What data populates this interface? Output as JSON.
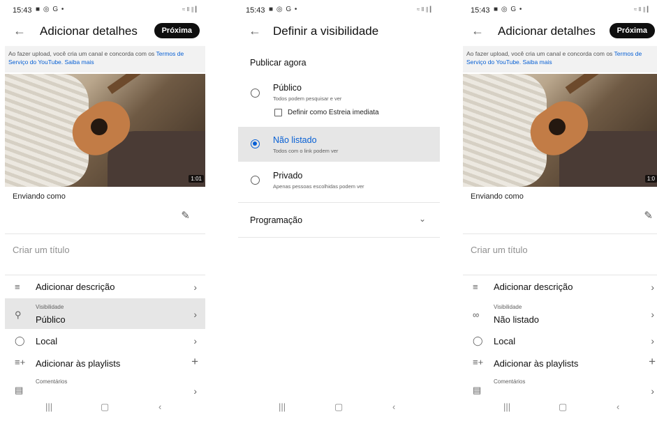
{
  "status": {
    "time": "15:43",
    "icons": "■ ◎ G •",
    "right": "≈ Ⅱ ∥ ▎"
  },
  "screens": {
    "details_public": {
      "back_icon": "←",
      "title": "Adicionar detalhes",
      "next_label": "Próxima",
      "banner_text": "Ao fazer upload, você cria um canal e concorda com os ",
      "banner_link1": "Termos de Serviço do YouTube.",
      "banner_link2": "Saiba mais",
      "duration": "1:01",
      "sending_as": "Enviando como",
      "title_placeholder": "Criar um título",
      "add_description": "Adicionar descrição",
      "visibility_label": "Visibilidade",
      "visibility_value": "Público",
      "location": "Local",
      "add_playlists": "Adicionar às playlists",
      "comments": "Comentários"
    },
    "visibility": {
      "back_icon": "←",
      "title": "Definir a visibilidade",
      "section": "Publicar agora",
      "options": [
        {
          "label": "Público",
          "sub": "Todos podem pesquisar e ver",
          "selected": false
        },
        {
          "label": "Não listado",
          "sub": "Todos com o link podem ver",
          "selected": true
        },
        {
          "label": "Privado",
          "sub": "Apenas pessoas escolhidas podem ver",
          "selected": false
        }
      ],
      "premiere_label": "Definir como Estreia imediata",
      "schedule": "Programação"
    },
    "details_unlisted": {
      "back_icon": "←",
      "title": "Adicionar detalhes",
      "next_label": "Próxima",
      "banner_text": "Ao fazer upload, você cria um canal e concorda com os ",
      "banner_link1": "Termos de Serviço do YouTube.",
      "banner_link2": "Saiba mais",
      "duration": "1:0",
      "sending_as": "Enviando como",
      "title_placeholder": "Criar um título",
      "add_description": "Adicionar descrição",
      "visibility_label": "Visibilidade",
      "visibility_value": "Não listado",
      "location": "Local",
      "add_playlists": "Adicionar às playlists",
      "comments": "Comentários"
    }
  },
  "colors": {
    "accent": "#065fd4",
    "highlight": "#e6e6e6",
    "button": "#0f0f0f"
  }
}
